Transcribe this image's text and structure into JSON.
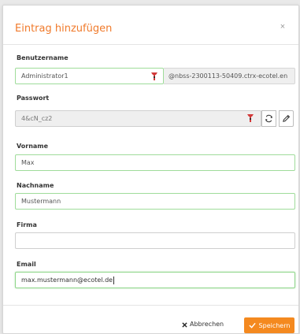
{
  "dialog": {
    "title": "Eintrag hinzufügen",
    "close_symbol": "×"
  },
  "fields": {
    "username": {
      "label": "Benutzername",
      "value": "Administrator1",
      "suffix": "@nbss-2300113-50409.ctrx-ecotel.en"
    },
    "password": {
      "label": "Passwort",
      "value": "4&cN_cz2"
    },
    "firstname": {
      "label": "Vorname",
      "value": "Max"
    },
    "lastname": {
      "label": "Nachname",
      "value": "Mustermann"
    },
    "company": {
      "label": "Firma",
      "value": ""
    },
    "email": {
      "label": "Email",
      "value": "max.mustermann@ecotel.de"
    }
  },
  "footer": {
    "cancel_label": "Abbrechen",
    "save_label": "Speichern"
  },
  "colors": {
    "accent": "#f07a2b",
    "save_button": "#f4891f",
    "valid_border": "#9fdc9a"
  },
  "icons": {
    "password_manager": "keeper-key-icon",
    "regenerate": "refresh-icon",
    "edit": "pencil-icon",
    "cancel": "x-icon",
    "save": "check-icon"
  }
}
